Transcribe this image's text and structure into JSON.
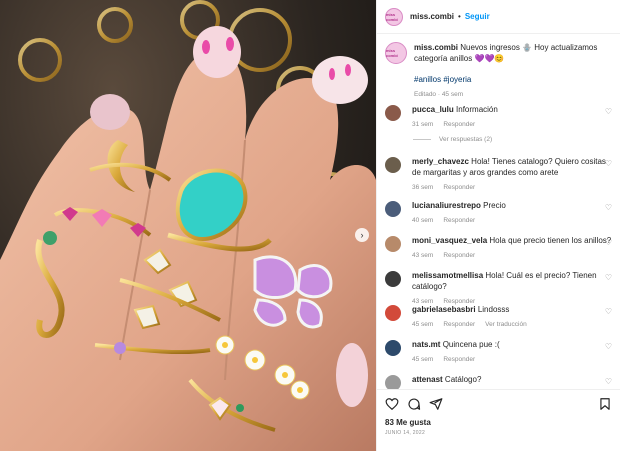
{
  "post": {
    "username": "miss.combi",
    "follow_label": "Seguir",
    "separator": "•",
    "avatar_text": "miss combi",
    "caption": "Nuevos ingresos 🪬 Hoy actualizamos categoría anillos 💜💜😊",
    "hashtags": "#anillos #joyeria",
    "edited": "Editado · 45 sem"
  },
  "comments": [
    {
      "user": "pucca_lulu",
      "text": "Información",
      "time": "31 sem",
      "reply": "Responder",
      "extra": "",
      "color": "#8a5a4a"
    },
    {
      "user": "merly_chavezc",
      "text": "Hola! Tienes catalogo? Quiero cositas de margaritas y aros grandes como arete",
      "time": "36 sem",
      "reply": "Responder",
      "extra": "",
      "color": "#6b5e4c"
    },
    {
      "user": "lucianaliurestrepo",
      "text": "Precio",
      "time": "40 sem",
      "reply": "Responder",
      "extra": "",
      "color": "#4b5d7a"
    },
    {
      "user": "moni_vasquez_vela",
      "text": "Hola que precio tienen los anillos?",
      "time": "43 sem",
      "reply": "Responder",
      "extra": "",
      "color": "#b78a6a"
    },
    {
      "user": "melissamotmellisa",
      "text": "Hola! Cuál es el precio? Tienen catálogo?",
      "time": "43 sem",
      "reply": "Responder",
      "extra": "",
      "color": "#3b3b3b"
    },
    {
      "user": "gabrielasebasbri",
      "text": "Lindosss",
      "time": "45 sem",
      "reply": "Responder",
      "extra": "Ver traducción",
      "color": "#d24a3a"
    },
    {
      "user": "nats.mt",
      "text": "Quincena pue :(",
      "time": "45 sem",
      "reply": "Responder",
      "extra": "",
      "color": "#2d4a6b"
    },
    {
      "user": "attenast",
      "text": "Catálogo?",
      "time": "",
      "reply": "",
      "extra": "",
      "color": "#9a9a9a"
    }
  ],
  "view_replies": "Ver respuestas (2)",
  "likes": "83 Me gusta",
  "date": "JUNIO 14, 2022",
  "icons": [
    "heart-icon",
    "comment-icon",
    "share-icon",
    "save-icon",
    "next-arrow-icon"
  ]
}
